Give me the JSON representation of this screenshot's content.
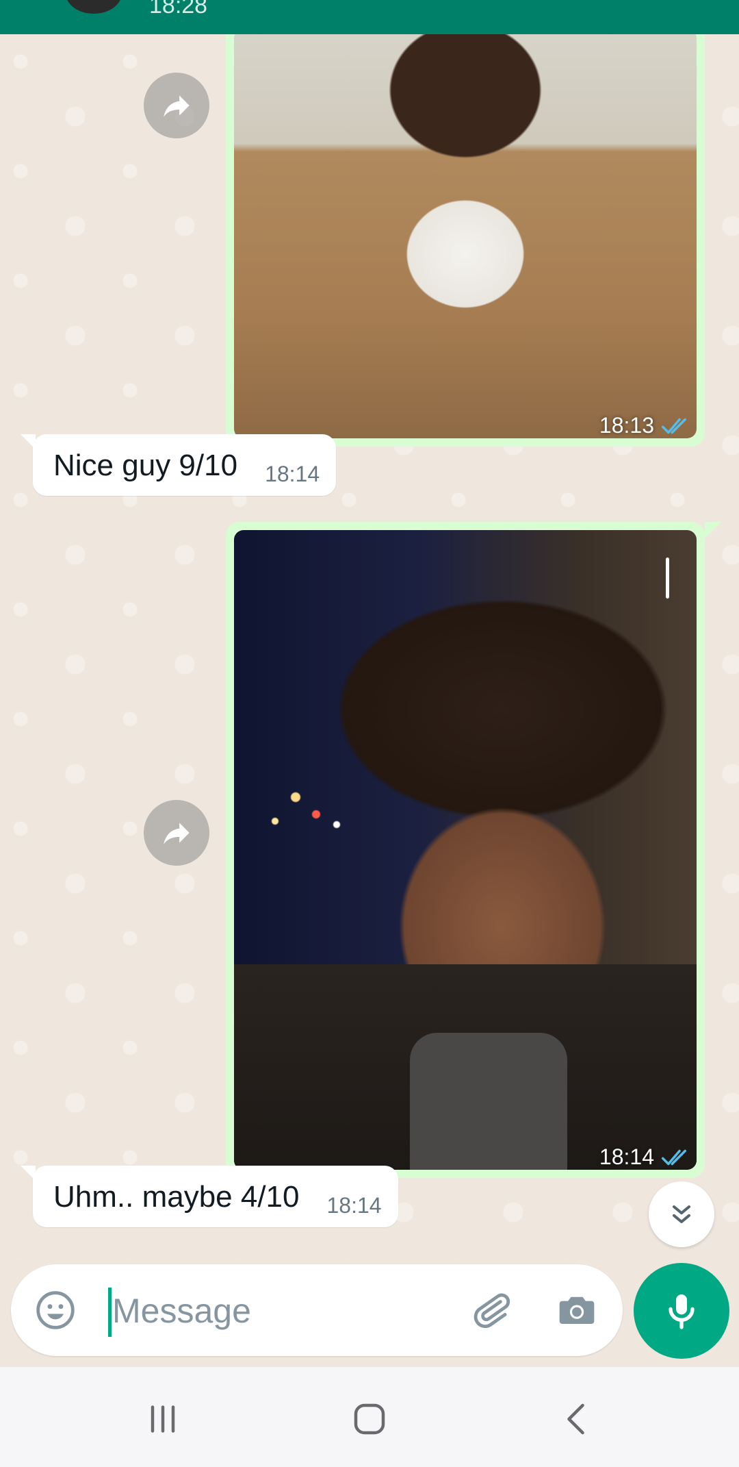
{
  "header": {
    "last_seen": "18:28"
  },
  "messages": [
    {
      "direction": "outgoing",
      "type": "photo",
      "time": "18:13",
      "status": "read"
    },
    {
      "direction": "incoming",
      "type": "text",
      "text": "Nice guy 9/10",
      "time": "18:14"
    },
    {
      "direction": "outgoing",
      "type": "photo",
      "time": "18:14",
      "status": "read"
    },
    {
      "direction": "incoming",
      "type": "text",
      "text": "Uhm.. maybe 4/10",
      "time": "18:14"
    }
  ],
  "composer": {
    "placeholder": "Message",
    "value": ""
  },
  "icons": {
    "forward": "forward-icon",
    "read_receipt": "double-check-icon",
    "scroll_down": "double-chevron-down-icon",
    "emoji": "emoji-icon",
    "attach": "paperclip-icon",
    "camera": "camera-icon",
    "mic": "mic-icon",
    "nav_recents": "recents-icon",
    "nav_home": "home-icon",
    "nav_back": "back-icon"
  },
  "colors": {
    "brand": "#008069",
    "accent": "#00a884",
    "outgoing_bubble": "#d9fdd3",
    "incoming_bubble": "#ffffff",
    "read_tick": "#53bdeb",
    "chat_background": "#efe7de"
  }
}
